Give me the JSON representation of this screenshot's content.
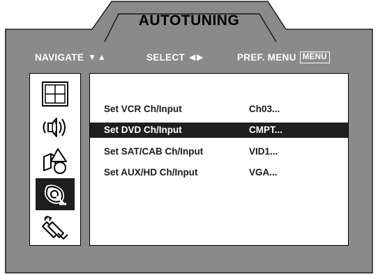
{
  "menu": {
    "title": "AUTOTUNING",
    "navigate_label": "NAVIGATE",
    "navigate_arrows": "▼▲",
    "select_label": "SELECT",
    "select_arrows": "◀▶",
    "pref_menu_label": "PREF. MENU",
    "menu_key": "MENU"
  },
  "colors": {
    "panel_gray": "#8a8a8a",
    "highlight": "#1e1e1e",
    "text_light": "#ffffff",
    "text_dark": "#1a1a1a"
  },
  "sidebar": {
    "items": [
      {
        "icon": "picture-grid-icon",
        "selected": false
      },
      {
        "icon": "speaker-sound-icon",
        "selected": false
      },
      {
        "icon": "shapes-icon",
        "selected": false
      },
      {
        "icon": "satellite-dish-icon",
        "selected": true
      },
      {
        "icon": "plug-cable-icon",
        "selected": false
      }
    ]
  },
  "rows": [
    {
      "label": "Set VCR Ch/Input",
      "value": "Ch03...",
      "highlighted": false
    },
    {
      "label": "Set DVD Ch/Input",
      "value": "CMPT...",
      "highlighted": true
    },
    {
      "label": "Set SAT/CAB Ch/Input",
      "value": "VID1...",
      "highlighted": false
    },
    {
      "label": "Set AUX/HD Ch/Input",
      "value": "VGA...",
      "highlighted": false
    }
  ]
}
